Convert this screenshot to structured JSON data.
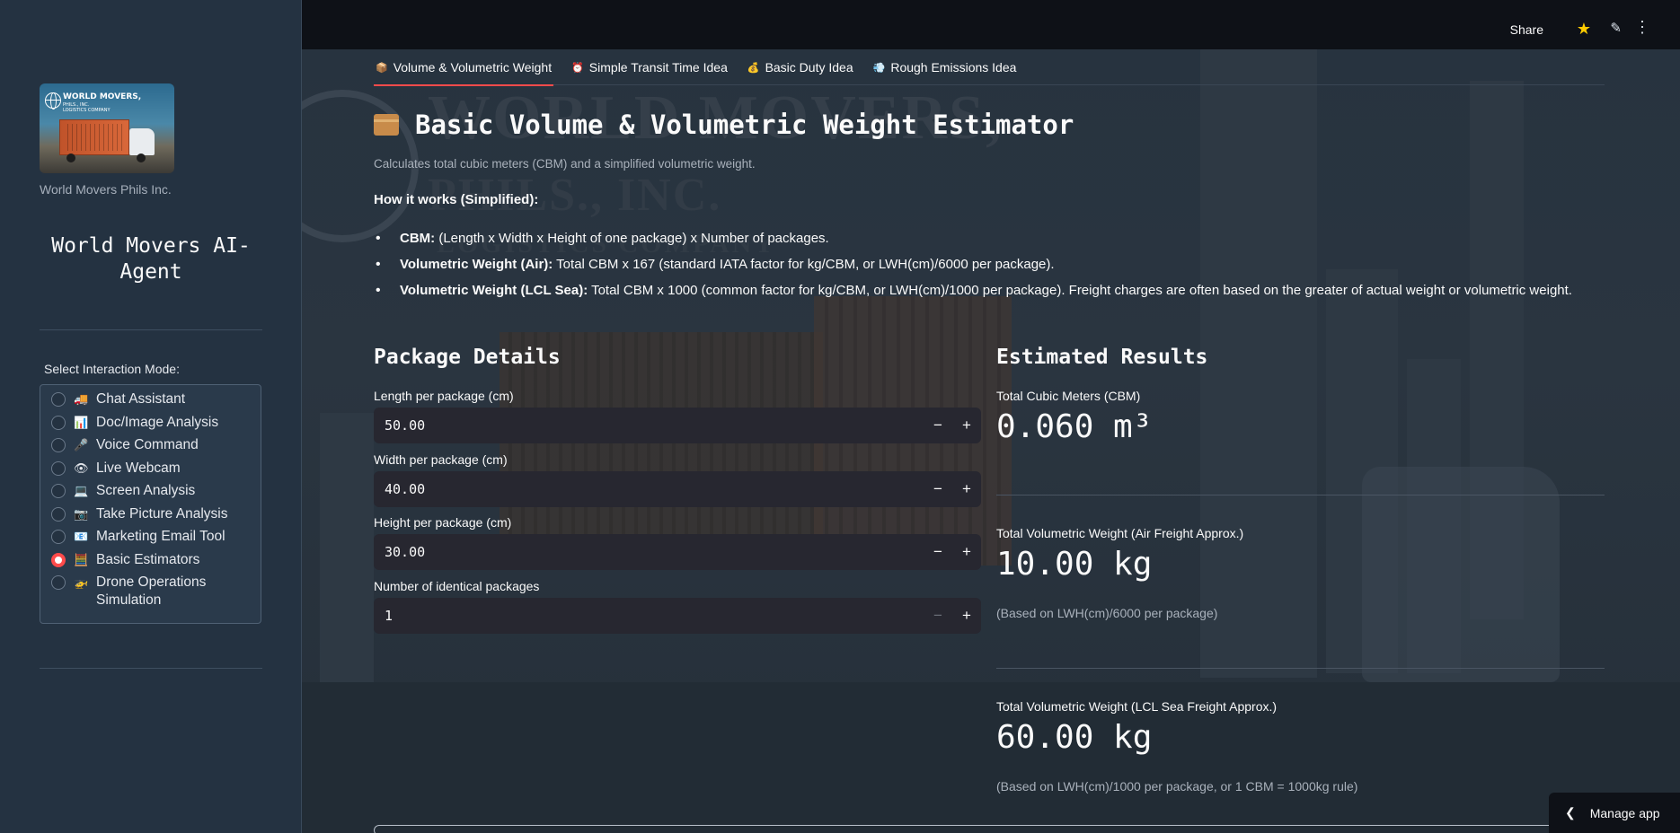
{
  "sidebar": {
    "logo": {
      "line1": "WORLD MOVERS,",
      "line2": "PHILS., INC.",
      "line3": "LOGISTICS COMPANY"
    },
    "company_caption": "World Movers Phils Inc.",
    "title": "World Movers AI-Agent",
    "mode_label": "Select Interaction Mode:",
    "modes": [
      {
        "icon": "🚚",
        "label": "Chat Assistant",
        "selected": false
      },
      {
        "icon": "📊",
        "label": "Doc/Image Analysis",
        "selected": false
      },
      {
        "icon": "🎤",
        "label": "Voice Command",
        "selected": false
      },
      {
        "icon": "👁",
        "label": "Live Webcam",
        "selected": false
      },
      {
        "icon": "💻",
        "label": "Screen Analysis",
        "selected": false
      },
      {
        "icon": "📷",
        "label": "Take Picture Analysis",
        "selected": false
      },
      {
        "icon": "📧",
        "label": "Marketing Email Tool",
        "selected": false
      },
      {
        "icon": "🧮",
        "label": "Basic Estimators",
        "selected": true
      },
      {
        "icon": "🚁",
        "label": "Drone Operations Simulation",
        "selected": false
      }
    ]
  },
  "topbar": {
    "share": "Share"
  },
  "tabs": [
    {
      "icon": "📦",
      "label": "Volume & Volumetric Weight",
      "active": true
    },
    {
      "icon": "⏰",
      "label": "Simple Transit Time Idea",
      "active": false
    },
    {
      "icon": "💰",
      "label": "Basic Duty Idea",
      "active": false
    },
    {
      "icon": "💨",
      "label": "Rough Emissions Idea",
      "active": false
    }
  ],
  "background_watermark": {
    "line1": "WORLD MOVERS,",
    "line2": "PHILS., INC.",
    "line3": "LOGISTICS COMPANY"
  },
  "page": {
    "title": "Basic Volume & Volumetric Weight Estimator",
    "subtitle": "Calculates total cubic meters (CBM) and a simplified volumetric weight.",
    "how_title": "How it works (Simplified):",
    "bullets": [
      {
        "bold": "CBM:",
        "text": " (Length x Width x Height of one package) x Number of packages."
      },
      {
        "bold": "Volumetric Weight (Air):",
        "text": " Total CBM x 167 (standard IATA factor for kg/CBM, or LWH(cm)/6000 per package)."
      },
      {
        "bold": "Volumetric Weight (LCL Sea):",
        "text": " Total CBM x 1000 (common factor for kg/CBM, or LWH(cm)/1000 per package). Freight charges are often based on the greater of actual weight or volumetric weight."
      }
    ]
  },
  "package": {
    "title": "Package Details",
    "fields": [
      {
        "label": "Length per package (cm)",
        "value": "50.00"
      },
      {
        "label": "Width per package (cm)",
        "value": "40.00"
      },
      {
        "label": "Height per package (cm)",
        "value": "30.00"
      },
      {
        "label": "Number of identical packages",
        "value": "1"
      }
    ],
    "minus": "−",
    "plus": "+"
  },
  "results": {
    "title": "Estimated Results",
    "cbm_label": "Total Cubic Meters (CBM)",
    "cbm_value": "0.060 m³",
    "air_label": "Total Volumetric Weight (Air Freight Approx.)",
    "air_value": "10.00 kg",
    "air_note": "(Based on LWH(cm)/6000 per package)",
    "sea_label": "Total Volumetric Weight (LCL Sea Freight Approx.)",
    "sea_value": "60.00 kg",
    "sea_note": "(Based on LWH(cm)/1000 per package, or 1 CBM = 1000kg rule)"
  },
  "manage_app": "Manage app",
  "colors": {
    "accent": "#ff4b4b",
    "sidebar_bg": "#243241",
    "topbar_bg": "#0e1117",
    "input_bg": "#272730"
  }
}
